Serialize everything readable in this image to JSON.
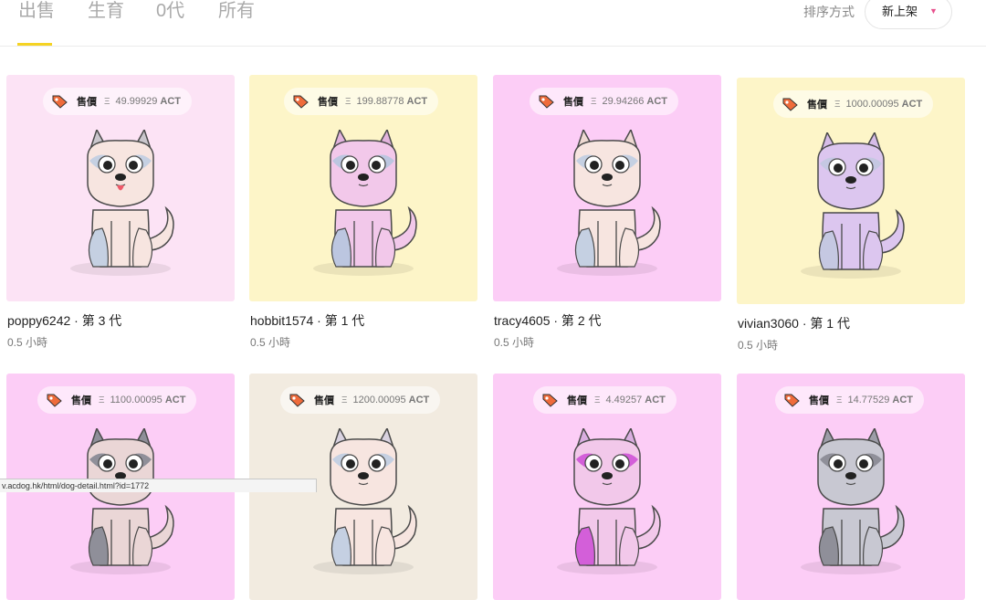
{
  "tabs": [
    {
      "label": "出售",
      "active": true
    },
    {
      "label": "生育",
      "active": false
    },
    {
      "label": "0代",
      "active": false
    },
    {
      "label": "所有",
      "active": false
    }
  ],
  "sort": {
    "label": "排序方式",
    "value": "新上架"
  },
  "sale_label": "售價",
  "eth_symbol": "Ξ",
  "currency": "ACT",
  "colors": {
    "accent": "#f5d323",
    "caret": "#e8528e",
    "tag": "#ef6b3b"
  },
  "dogs": [
    {
      "price": "49.99929",
      "name": "poppy6242 · 第 3 代",
      "time": "0.5 小時",
      "bg": "#fce3f5",
      "fur": "#f7e5e0",
      "patch": "#c5d0e2",
      "ear": "#c9c6cc"
    },
    {
      "price": "199.88778",
      "name": "hobbit1574 · 第 1 代",
      "time": "0.5 小時",
      "bg": "#fdf5c8",
      "fur": "#f2c8ea",
      "patch": "#bcc6e0",
      "ear": "#e2b3dd"
    },
    {
      "price": "29.94266",
      "name": "tracy4605 · 第 2 代",
      "time": "0.5 小時",
      "bg": "#fccdf6",
      "fur": "#f7e5e0",
      "patch": "#c5d0e2",
      "ear": "#eed9d2"
    },
    {
      "price": "1000.00095",
      "name": "vivian3060 · 第 1 代",
      "time": "0.5 小時",
      "bg": "#fdf5c8",
      "fur": "#dcc6ef",
      "patch": "#c5c8e2",
      "ear": "#d6bce8"
    },
    {
      "price": "1100.00095",
      "bg": "#fccdf6",
      "fur": "#ead6d6",
      "patch": "#8f8f99",
      "ear": "#8f8f99"
    },
    {
      "price": "1200.00095",
      "bg": "#f2ebe0",
      "fur": "#f7e5e0",
      "patch": "#c5d0e2",
      "ear": "#d9d2e0"
    },
    {
      "price": "4.49257",
      "bg": "#fccdf6",
      "fur": "#f2c8ea",
      "patch": "#d35fd9",
      "ear": "#d9aee0"
    },
    {
      "price": "14.77529",
      "bg": "#fccdf6",
      "fur": "#c8c8d2",
      "patch": "#8f8f99",
      "ear": "#9d9da8"
    }
  ],
  "status_url": "v.acdog.hk/html/dog-detail.html?id=1772"
}
